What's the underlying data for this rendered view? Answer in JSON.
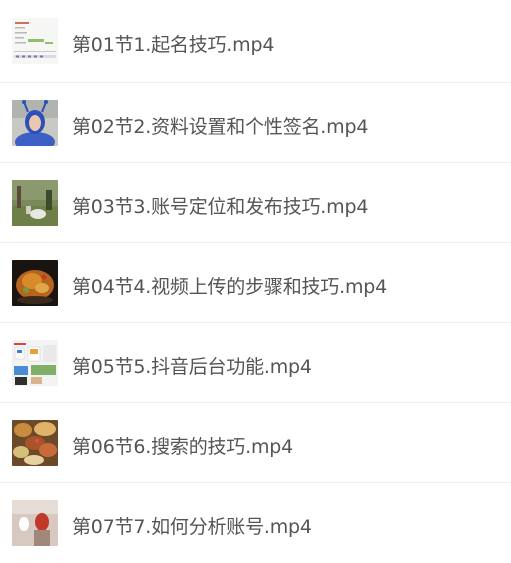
{
  "files": [
    {
      "name": "第01节1.起名技巧.mp4",
      "thumb": "spreadsheet-thumbnail"
    },
    {
      "name": "第02节2.资料设置和个性签名.mp4",
      "thumb": "portrait-thumbnail"
    },
    {
      "name": "第03节3.账号定位和发布技巧.mp4",
      "thumb": "outdoor-scene-thumbnail"
    },
    {
      "name": "第04节4.视频上传的步骤和技巧.mp4",
      "thumb": "food-thumbnail"
    },
    {
      "name": "第05节5.抖音后台功能.mp4",
      "thumb": "app-screens-thumbnail"
    },
    {
      "name": "第06节6.搜索的技巧.mp4",
      "thumb": "food-table-thumbnail"
    },
    {
      "name": "第07节7.如何分析账号.mp4",
      "thumb": "room-scene-thumbnail"
    }
  ]
}
